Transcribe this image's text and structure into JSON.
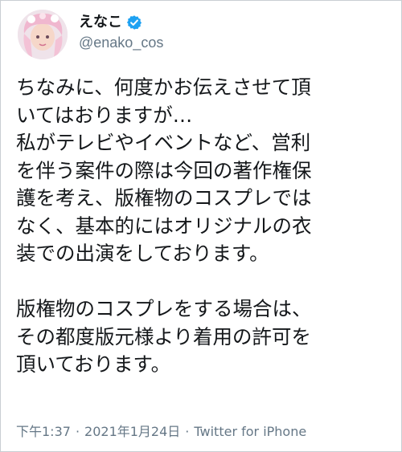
{
  "tweet": {
    "author": {
      "display_name": "えなこ",
      "handle": "@enako_cos",
      "verified_icon": "verified-badge-icon",
      "avatar_icon": "avatar-image"
    },
    "text_lines": [
      "ちなみに、何度かお伝えさせて頂",
      "いてはおりますが…",
      "私がテレビやイベントなど、営利",
      "を伴う案件の際は今回の著作権保",
      "護を考え、版権物のコスプレでは",
      "なく、基本的にはオリジナルの衣",
      "装での出演をしております。",
      "",
      "版権物のコスプレをする場合は、",
      "その都度版元様より着用の許可を",
      "頂いております。"
    ],
    "time": "下午1:37",
    "separator": "·",
    "date": "2021年1月24日",
    "source": "Twitter for iPhone"
  },
  "colors": {
    "verified": "#1da1f2",
    "text": "#14171a",
    "muted": "#657786"
  }
}
